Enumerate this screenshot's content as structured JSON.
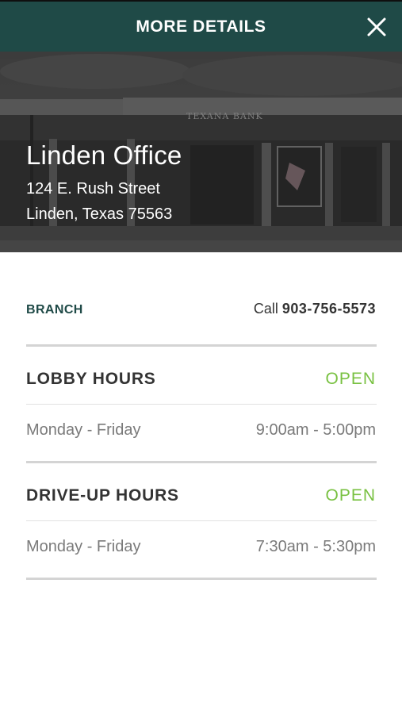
{
  "header": {
    "title": "MORE DETAILS",
    "close_icon": "close-icon"
  },
  "hero": {
    "office_name": "Linden Office",
    "address_line1": "124 E. Rush Street",
    "address_line2": "Linden, Texas 75563",
    "sign_text": "TEXANA BANK"
  },
  "branch": {
    "label": "BRANCH",
    "call_prefix": "Call ",
    "phone": "903-756-5573"
  },
  "lobby": {
    "title": "LOBBY HOURS",
    "status": "OPEN",
    "days": "Monday - Friday",
    "hours": "9:00am - 5:00pm"
  },
  "drive_up": {
    "title": "DRIVE-UP HOURS",
    "status": "OPEN",
    "days": "Monday - Friday",
    "hours": "7:30am - 5:30pm"
  },
  "colors": {
    "header_bg": "#1f4a47",
    "open_status": "#79c142",
    "branch_label": "#1f4a47"
  }
}
